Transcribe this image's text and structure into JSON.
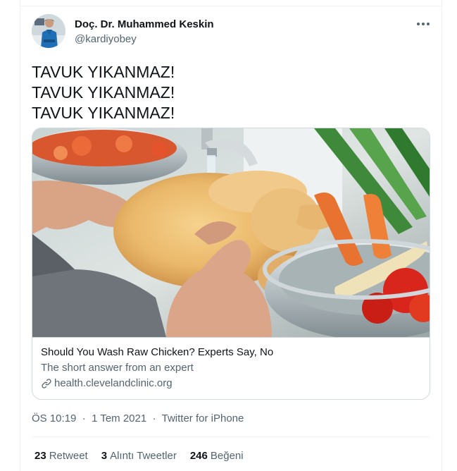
{
  "tweet": {
    "author": {
      "name": "Doç. Dr. Muhammed Keskin",
      "handle": "@kardiyobey"
    },
    "text_lines": [
      "TAVUK YIKANMAZ!",
      "TAVUK YIKANMAZ!",
      "TAVUK YIKANMAZ!"
    ],
    "card": {
      "image_subject": "hands washing raw chicken under kitchen tap with vegetables",
      "title": "Should You Wash Raw Chicken? Experts Say, No",
      "description": "The short answer from an expert",
      "domain": "health.clevelandclinic.org"
    },
    "time": "ÖS 10:19",
    "date": "1 Tem 2021",
    "separator": "·",
    "source": "Twitter for iPhone",
    "stats": {
      "retweets": {
        "count": "23",
        "label": "Retweet"
      },
      "quotes": {
        "count": "3",
        "label": "Alıntı Tweetler"
      },
      "likes": {
        "count": "246",
        "label": "Beğeni"
      }
    }
  },
  "colors": {
    "text_primary": "#0f1419",
    "text_secondary": "#536471",
    "border": "#cfd9de",
    "divider": "#eff3f4"
  },
  "icons": [
    "more-icon",
    "link-icon"
  ]
}
